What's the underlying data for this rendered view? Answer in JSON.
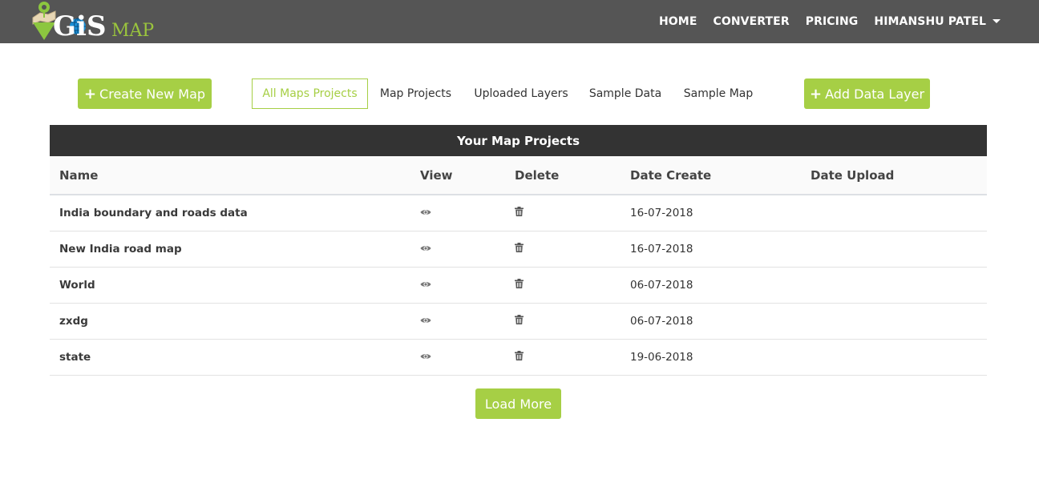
{
  "brand": {
    "logo_text": "GiS",
    "logo_suffix": "MAP",
    "colors": {
      "accent": "#a6cf45",
      "navbar": "#555555",
      "table_header": "#333333"
    }
  },
  "nav": {
    "items": [
      {
        "label": "HOME"
      },
      {
        "label": "CONVERTER"
      },
      {
        "label": "PRICING"
      },
      {
        "label": "HIMANSHU PATEL",
        "icon": "caret-down-icon"
      }
    ]
  },
  "toolbar": {
    "create_label": "Create New Map",
    "create_icon": "plus-icon",
    "add_layer_label": "Add Data Layer",
    "add_layer_icon": "plus-icon",
    "tabs": [
      {
        "label": "All Maps Projects",
        "active": true
      },
      {
        "label": "Map Projects",
        "active": false
      },
      {
        "label": "Uploaded Layers",
        "active": false
      },
      {
        "label": "Sample Data",
        "active": false
      },
      {
        "label": "Sample Map",
        "active": false
      }
    ]
  },
  "table": {
    "title": "Your Map Projects",
    "columns": [
      "Name",
      "View",
      "Delete",
      "Date Create",
      "Date Upload"
    ],
    "rows": [
      {
        "name": "India boundary and roads data",
        "view_icon": "eye-icon",
        "delete_icon": "trash-icon",
        "date_create": "16-07-2018",
        "date_upload": ""
      },
      {
        "name": "New India road map",
        "view_icon": "eye-icon",
        "delete_icon": "trash-icon",
        "date_create": "16-07-2018",
        "date_upload": ""
      },
      {
        "name": "World",
        "view_icon": "eye-icon",
        "delete_icon": "trash-icon",
        "date_create": "06-07-2018",
        "date_upload": ""
      },
      {
        "name": "zxdg",
        "view_icon": "eye-icon",
        "delete_icon": "trash-icon",
        "date_create": "06-07-2018",
        "date_upload": ""
      },
      {
        "name": "state",
        "view_icon": "eye-icon",
        "delete_icon": "trash-icon",
        "date_create": "19-06-2018",
        "date_upload": ""
      }
    ]
  },
  "footer": {
    "load_more_label": "Load More"
  }
}
